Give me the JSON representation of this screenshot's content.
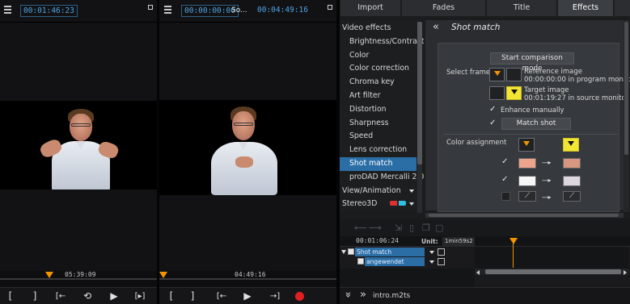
{
  "left_monitor": {
    "timecode": "00:01:46:23",
    "scrub_timecode": "05:39:09",
    "controls": {
      "mark_in": "[",
      "mark_out": "]",
      "prev_marker": "[←",
      "loop": "⟲",
      "play": "▶",
      "next": "[▸]"
    }
  },
  "right_monitor": {
    "timecode_start": "00:00:00:00",
    "source_label": "So...",
    "timecode_end": "00:04:49:16",
    "scrub_timecode": "04:49:16",
    "controls": {
      "mark_in": "[",
      "mark_out": "]",
      "prev": "[←",
      "play": "▶",
      "next": "→]"
    }
  },
  "tabs": [
    {
      "label": "Import",
      "active": false
    },
    {
      "label": "Fades",
      "active": false
    },
    {
      "label": "Title",
      "active": false
    },
    {
      "label": "Effects",
      "active": true
    }
  ],
  "effects_list": {
    "items": [
      {
        "label": "Video effects",
        "indent": false,
        "selected": false
      },
      {
        "label": "Brightness/Contrast",
        "indent": true,
        "selected": false
      },
      {
        "label": "Color",
        "indent": true,
        "selected": false
      },
      {
        "label": "Color correction",
        "indent": true,
        "selected": false
      },
      {
        "label": "Chroma key",
        "indent": true,
        "selected": false
      },
      {
        "label": "Art filter",
        "indent": true,
        "selected": false
      },
      {
        "label": "Distortion",
        "indent": true,
        "selected": false
      },
      {
        "label": "Sharpness",
        "indent": true,
        "selected": false
      },
      {
        "label": "Speed",
        "indent": true,
        "selected": false
      },
      {
        "label": "Lens correction",
        "indent": true,
        "selected": false
      },
      {
        "label": "Shot match",
        "indent": true,
        "selected": true
      },
      {
        "label": "proDAD Mercalli 2.0",
        "indent": true,
        "selected": false
      },
      {
        "label": "View/Animation",
        "indent": false,
        "selected": false
      },
      {
        "label": "Stereo3D",
        "indent": false,
        "selected": false
      }
    ]
  },
  "shot_match": {
    "back_icon": "«",
    "title": "Shot match",
    "comparison_button": "Start comparison mode",
    "select_frames_label": "Select frames",
    "reference_label": "Reference image",
    "reference_detail": "00:00:00:00 in program monitor",
    "target_label": "Target image",
    "target_detail": "00:01:19:27 in source monitor",
    "enhance_label": "Enhance manually",
    "match_shot_button": "Match shot",
    "color_assignment_label": "Color assignment",
    "swatches": [
      {
        "from": "#eda48c",
        "to": "#d69680",
        "checked": true
      },
      {
        "from": "#f6f6f8",
        "to": "#dcd6e0",
        "checked": true
      },
      {
        "from": "",
        "to": "",
        "checked": false
      }
    ],
    "arrow": "----▸"
  },
  "timeline": {
    "timecode": "00:01:06:24",
    "unit_label": "Unit:",
    "unit_value": "1min59s2",
    "tracks": [
      {
        "name": "Shot match"
      },
      {
        "name": "angewendet"
      }
    ]
  },
  "bottom": {
    "file_name": "intro.m2ts",
    "chevron": "»"
  },
  "colors": {
    "accent_blue": "#2b6ea6",
    "marker_orange": "#f29400",
    "record_red": "#e02020"
  }
}
